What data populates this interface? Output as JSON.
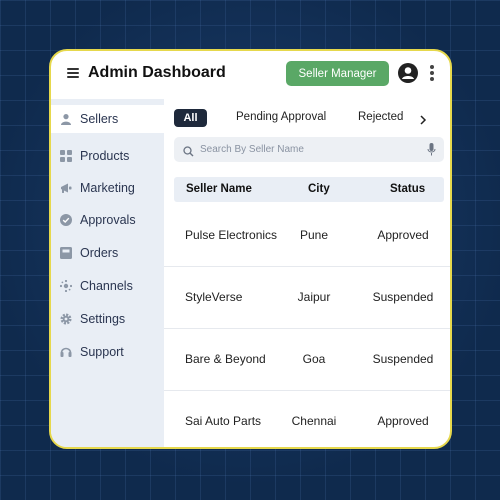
{
  "header": {
    "title": "Admin Dashboard",
    "primary_button": "Seller Manager",
    "menu_icon": "hamburger-icon",
    "avatar_icon": "user-avatar-icon",
    "more_icon": "kebab-menu-icon"
  },
  "sidebar": {
    "items": [
      {
        "label": "Sellers",
        "icon": "user-icon",
        "active": true
      },
      {
        "label": "Products",
        "icon": "grid-icon"
      },
      {
        "label": "Marketing",
        "icon": "megaphone-icon"
      },
      {
        "label": "Approvals",
        "icon": "check-circle-icon"
      },
      {
        "label": "Orders",
        "icon": "box-icon"
      },
      {
        "label": "Channels",
        "icon": "network-icon"
      },
      {
        "label": "Settings",
        "icon": "gear-icon"
      },
      {
        "label": "Support",
        "icon": "headset-icon"
      }
    ]
  },
  "tabs": [
    {
      "label": "All",
      "active": true
    },
    {
      "label": "Pending Approval"
    },
    {
      "label": "Rejected"
    }
  ],
  "search": {
    "placeholder": "Search By Seller Name",
    "value": ""
  },
  "table": {
    "columns": [
      "Seller Name",
      "City",
      "Status"
    ],
    "rows": [
      {
        "name": "Pulse Electronics",
        "city": "Pune",
        "status": "Approved"
      },
      {
        "name": "StyleVerse",
        "city": "Jaipur",
        "status": "Suspended"
      },
      {
        "name": "Bare & Beyond",
        "city": "Goa",
        "status": "Suspended"
      },
      {
        "name": "Sai Auto Parts",
        "city": "Chennai",
        "status": "Approved"
      }
    ]
  },
  "colors": {
    "accent_green": "#5aa866",
    "window_border": "#e6d84c",
    "background": "#0f2a4d",
    "sidebar_bg": "#e9eef5",
    "active_tab": "#1e293b"
  }
}
